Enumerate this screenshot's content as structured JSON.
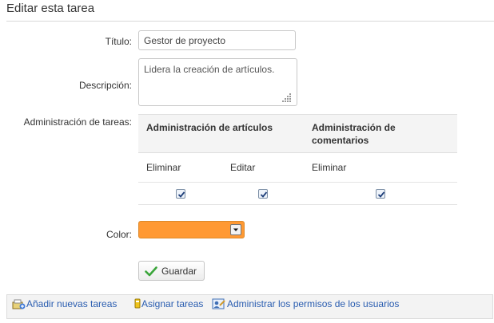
{
  "page": {
    "title": "Editar esta tarea"
  },
  "form": {
    "title_label": "Título:",
    "title_value": "Gestor de proyecto",
    "description_label": "Descripción:",
    "description_value": "Lidera la creación de artículos.",
    "admin_label": "Administración de tareas:",
    "color_label": "Color:",
    "color_value": "#ff9933"
  },
  "permissions": {
    "groups": [
      {
        "label": "Administración de artículos"
      },
      {
        "label": "Administración de comentarios"
      }
    ],
    "actions": [
      "Eliminar",
      "Editar",
      "Eliminar"
    ],
    "checked": [
      true,
      true,
      true
    ]
  },
  "actions": {
    "save_label": "Guardar"
  },
  "footer": {
    "links": [
      {
        "label": "Añadir nuevas tareas",
        "icon": "add-tasks-icon"
      },
      {
        "label": "Asignar tareas",
        "icon": "assign-tasks-icon"
      },
      {
        "label": "Administrar los permisos de los usuarios",
        "icon": "user-permissions-icon"
      }
    ]
  },
  "colors": {
    "link": "#2a5db0",
    "accent_orange": "#ff9933",
    "check_green": "#3aa53a"
  }
}
